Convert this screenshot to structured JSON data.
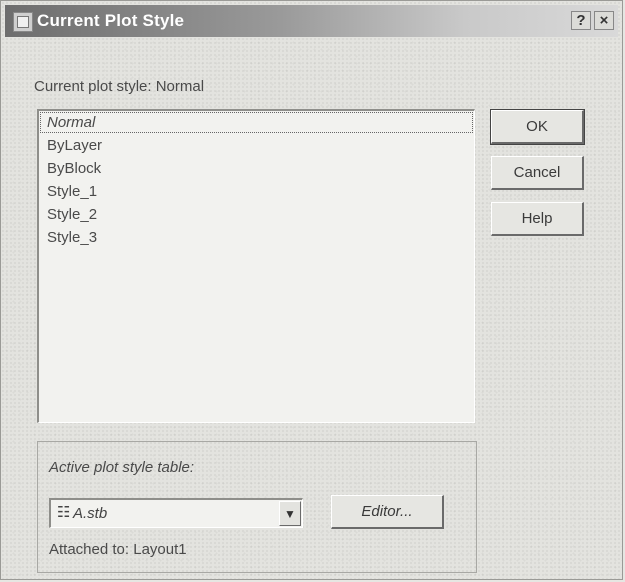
{
  "window": {
    "title": "Current Plot Style",
    "help_label": "?",
    "close_label": "×"
  },
  "current_style_label": "Current plot style: Normal",
  "styles": [
    "Normal",
    "ByLayer",
    "ByBlock",
    "Style_1",
    "Style_2",
    "Style_3"
  ],
  "selected_style": "Normal",
  "buttons": {
    "ok": "OK",
    "cancel": "Cancel",
    "help": "Help",
    "editor": "Editor..."
  },
  "table_group": {
    "label": "Active plot style table:",
    "value": "A.stb",
    "attached": "Attached to: Layout1"
  }
}
